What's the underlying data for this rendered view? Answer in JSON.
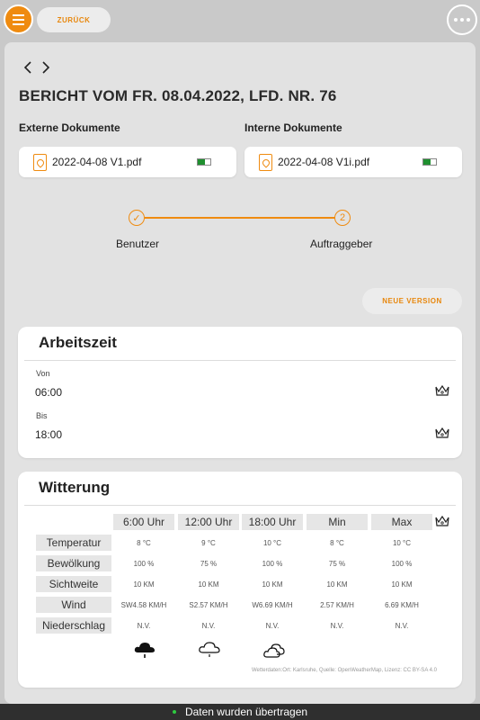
{
  "topbar": {
    "back_label": "ZURÜCK"
  },
  "report": {
    "title": "BERICHT VOM FR. 08.04.2022, LFD. NR. 76"
  },
  "documents": {
    "external_label": "Externe Dokumente",
    "external_file": "2022-04-08 V1.pdf",
    "internal_label": "Interne Dokumente",
    "internal_file": "2022-04-08 V1i.pdf"
  },
  "stepper": {
    "steps": [
      {
        "marker": "✓",
        "label": "Benutzer"
      },
      {
        "marker": "2",
        "label": "Auftraggeber"
      }
    ]
  },
  "actions": {
    "new_version_label": "NEUE VERSION"
  },
  "arbeitszeit": {
    "title": "Arbeitszeit",
    "from_label": "Von",
    "from_value": "06:00",
    "to_label": "Bis",
    "to_value": "18:00"
  },
  "witterung": {
    "title": "Witterung",
    "columns": [
      "6:00 Uhr",
      "12:00 Uhr",
      "18:00 Uhr",
      "Min",
      "Max"
    ],
    "rows": [
      {
        "label": "Temperatur",
        "values": [
          "8 °C",
          "9 °C",
          "10 °C",
          "8 °C",
          "10 °C"
        ]
      },
      {
        "label": "Bewölkung",
        "values": [
          "100 %",
          "75 %",
          "100 %",
          "75 %",
          "100 %"
        ]
      },
      {
        "label": "Sichtweite",
        "values": [
          "10 KM",
          "10 KM",
          "10 KM",
          "10 KM",
          "10 KM"
        ]
      },
      {
        "label": "Wind",
        "values": [
          "SW4.58 KM/H",
          "S2.57 KM/H",
          "W6.69 KM/H",
          "2.57 KM/H",
          "6.69 KM/H"
        ]
      },
      {
        "label": "Niederschlag",
        "values": [
          "N.V.",
          "N.V.",
          "N.V.",
          "N.V.",
          "N.V."
        ]
      }
    ],
    "icons": [
      "rain-cloud-icon",
      "light-rain-cloud-icon",
      "clouds-icon"
    ],
    "credit": "Wetterdaten:Ort: Karlsruhe, Quelle: OpenWeatherMap, Lizenz: CC BY-SA 4.0"
  },
  "status": {
    "message": "Daten wurden übertragen"
  },
  "colors": {
    "accent": "#ef8b10",
    "sync_green": "#1f8f2f",
    "status_bg": "#2f2f2f"
  }
}
